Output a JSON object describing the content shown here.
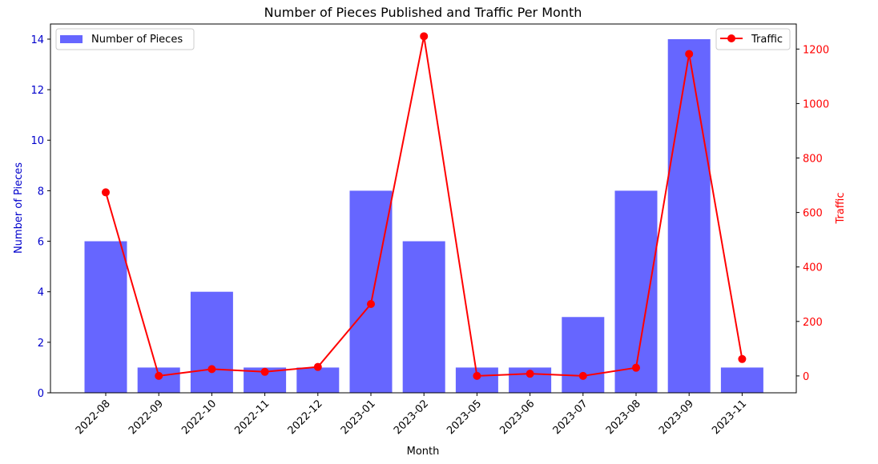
{
  "chart_data": {
    "type": "bar+line",
    "title": "Number of Pieces Published and Traffic Per Month",
    "xlabel": "Month",
    "categories": [
      "2022-08",
      "2022-09",
      "2022-10",
      "2022-11",
      "2022-12",
      "2023-01",
      "2023-02",
      "2023-05",
      "2023-06",
      "2023-07",
      "2023-08",
      "2023-09",
      "2023-11"
    ],
    "series": [
      {
        "name": "Number of Pieces",
        "type": "bar",
        "axis": "left",
        "color": "#6666ff",
        "values": [
          6,
          1,
          4,
          1,
          1,
          8,
          6,
          1,
          1,
          3,
          8,
          14,
          1
        ]
      },
      {
        "name": "Traffic",
        "type": "line",
        "axis": "right",
        "color": "#ff0000",
        "values": [
          674,
          0,
          25,
          15,
          33,
          264,
          1247,
          0,
          8,
          0,
          30,
          1182,
          62
        ]
      }
    ],
    "left_axis": {
      "label": "Number of Pieces",
      "color": "#0000cc",
      "ylim": [
        0,
        14.6
      ],
      "ticks": [
        0,
        2,
        4,
        6,
        8,
        10,
        12,
        14
      ]
    },
    "right_axis": {
      "label": "Traffic",
      "color": "#ff0000",
      "ylim": [
        -62,
        1292
      ],
      "ticks": [
        0,
        200,
        400,
        600,
        800,
        1000,
        1200
      ]
    },
    "legends": [
      {
        "label": "Number of Pieces",
        "placement": "top-left"
      },
      {
        "label": "Traffic",
        "placement": "top-right"
      }
    ],
    "grid": false
  }
}
